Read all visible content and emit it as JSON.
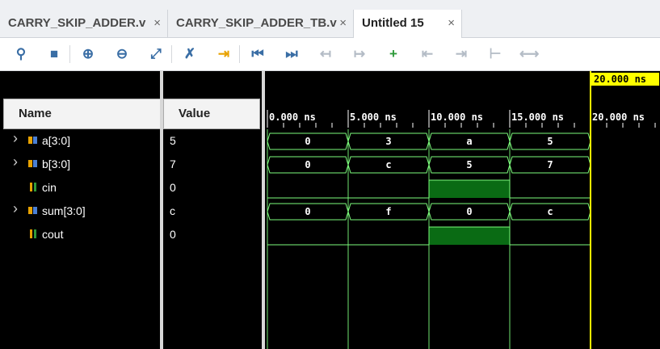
{
  "tabs": [
    {
      "label": "CARRY_SKIP_ADDER.v",
      "close": "×"
    },
    {
      "label": "CARRY_SKIP_ADDER_TB.v",
      "close": "×"
    },
    {
      "label": "Untitled 15",
      "close": "×"
    }
  ],
  "toolbar_icons": [
    "search-icon",
    "save-icon",
    "zoom-in-icon",
    "zoom-out-icon",
    "zoom-fit-icon",
    "cursor-remove-icon",
    "go-to-cursor-icon",
    "go-to-start-icon",
    "go-to-end-icon",
    "previous-transition-icon",
    "next-transition-icon",
    "add-marker-icon",
    "previous-marker-icon",
    "next-marker-icon",
    "swap-cursors-icon",
    "snap-to-transition-icon"
  ],
  "columns": {
    "name": "Name",
    "value": "Value"
  },
  "signals": [
    {
      "name": "a[3:0]",
      "value": "5",
      "bus": true,
      "segments": [
        "0",
        "3",
        "a",
        "5"
      ]
    },
    {
      "name": "b[3:0]",
      "value": "7",
      "bus": true,
      "segments": [
        "0",
        "c",
        "5",
        "7"
      ]
    },
    {
      "name": "cin",
      "value": "0",
      "bus": false,
      "levels": [
        0,
        0,
        1,
        0
      ]
    },
    {
      "name": "sum[3:0]",
      "value": "c",
      "bus": true,
      "segments": [
        "0",
        "f",
        "0",
        "c"
      ]
    },
    {
      "name": "cout",
      "value": "0",
      "bus": false,
      "levels": [
        0,
        0,
        1,
        0
      ]
    }
  ],
  "time_axis": {
    "ticks": [
      "0.000 ns",
      "5.000 ns",
      "10.000 ns",
      "15.000 ns",
      "20.000 ns"
    ],
    "cursor": "20.000 ns"
  },
  "colors": {
    "wave": "#7cfc7c",
    "high_fill": "#0a6b14",
    "cursor": "#ffff00",
    "background": "#000000"
  }
}
